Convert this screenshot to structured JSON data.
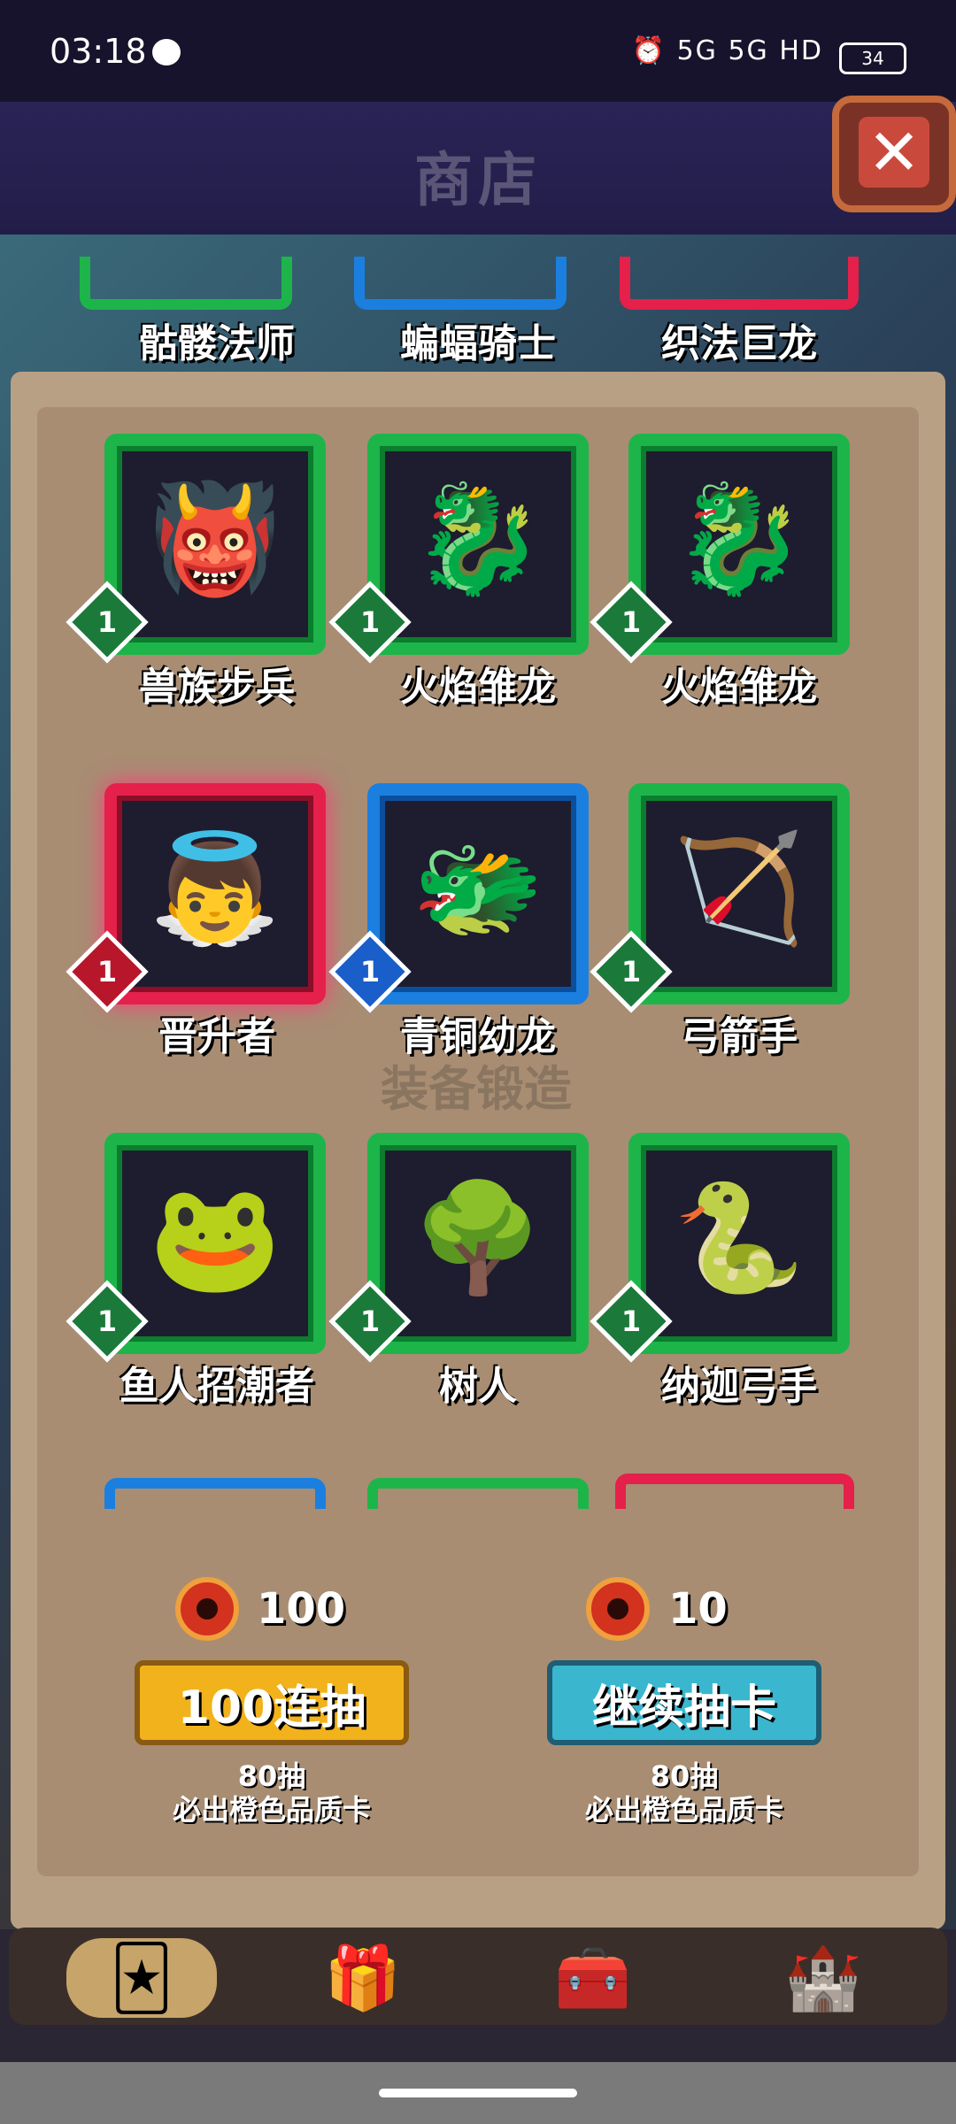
{
  "status_bar": {
    "time": "03:18",
    "signals": "⏰ 5G 5G HD",
    "battery": "34"
  },
  "header": {
    "title": "商店",
    "close_label": "✕"
  },
  "background_text": {
    "forge": "装备锻造"
  },
  "top_row_labels": [
    "骷髅法师",
    "蝙蝠骑士",
    "织法巨龙"
  ],
  "cards": [
    {
      "name": "兽族步兵",
      "level": "1",
      "rarity": "green",
      "art": "👹"
    },
    {
      "name": "火焰雏龙",
      "level": "1",
      "rarity": "green",
      "art": "🐉"
    },
    {
      "name": "火焰雏龙",
      "level": "1",
      "rarity": "green",
      "art": "🐉"
    },
    {
      "name": "晋升者",
      "level": "1",
      "rarity": "red",
      "art": "👼"
    },
    {
      "name": "青铜幼龙",
      "level": "1",
      "rarity": "blue",
      "art": "🐲"
    },
    {
      "name": "弓箭手",
      "level": "1",
      "rarity": "green",
      "art": "🏹"
    },
    {
      "name": "鱼人招潮者",
      "level": "1",
      "rarity": "green",
      "art": "🐸"
    },
    {
      "name": "树人",
      "level": "1",
      "rarity": "green",
      "art": "🌳"
    },
    {
      "name": "纳迦弓手",
      "level": "1",
      "rarity": "green",
      "art": "🐍"
    }
  ],
  "draw": {
    "left": {
      "cost": "100",
      "button": "100连抽",
      "note_line1": "80抽",
      "note_line2": "必出橙色品质卡"
    },
    "right": {
      "cost": "10",
      "button": "继续抽卡",
      "note_line1": "80抽",
      "note_line2": "必出橙色品质卡"
    }
  },
  "nav": [
    {
      "name": "card-pack-icon",
      "glyph": "🃏"
    },
    {
      "name": "gift-icon",
      "glyph": "🎁"
    },
    {
      "name": "treasure-chest-icon",
      "glyph": "🧰"
    },
    {
      "name": "building-icon",
      "glyph": "🏰"
    }
  ],
  "colors": {
    "green": "#1db54a",
    "blue": "#1b7fe0",
    "red": "#e5204a",
    "gold_button": "#f2b21c",
    "cyan_button": "#3bb6cf"
  }
}
